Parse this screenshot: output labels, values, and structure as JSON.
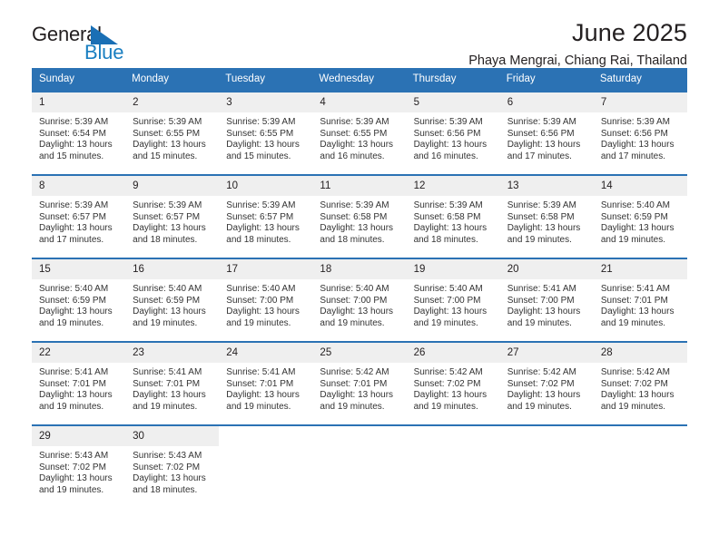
{
  "brand": {
    "name_top": "General",
    "name_bottom": "Blue",
    "flag_icon": "blue-flag-triangle-icon",
    "top_color": "#231f20",
    "bottom_color": "#1a7fc1"
  },
  "header": {
    "title": "June 2025",
    "subtitle": "Phaya Mengrai, Chiang Rai, Thailand"
  },
  "theme": {
    "header_blue": "#2b72b4",
    "daynum_band": "#efefef",
    "text": "#231f20"
  },
  "calendar": {
    "weekday_headers": [
      "Sunday",
      "Monday",
      "Tuesday",
      "Wednesday",
      "Thursday",
      "Friday",
      "Saturday"
    ],
    "weeks": [
      [
        {
          "day": "1",
          "sunrise": "Sunrise: 5:39 AM",
          "sunset": "Sunset: 6:54 PM",
          "daylight_line1": "Daylight: 13 hours",
          "daylight_line2": "and 15 minutes."
        },
        {
          "day": "2",
          "sunrise": "Sunrise: 5:39 AM",
          "sunset": "Sunset: 6:55 PM",
          "daylight_line1": "Daylight: 13 hours",
          "daylight_line2": "and 15 minutes."
        },
        {
          "day": "3",
          "sunrise": "Sunrise: 5:39 AM",
          "sunset": "Sunset: 6:55 PM",
          "daylight_line1": "Daylight: 13 hours",
          "daylight_line2": "and 15 minutes."
        },
        {
          "day": "4",
          "sunrise": "Sunrise: 5:39 AM",
          "sunset": "Sunset: 6:55 PM",
          "daylight_line1": "Daylight: 13 hours",
          "daylight_line2": "and 16 minutes."
        },
        {
          "day": "5",
          "sunrise": "Sunrise: 5:39 AM",
          "sunset": "Sunset: 6:56 PM",
          "daylight_line1": "Daylight: 13 hours",
          "daylight_line2": "and 16 minutes."
        },
        {
          "day": "6",
          "sunrise": "Sunrise: 5:39 AM",
          "sunset": "Sunset: 6:56 PM",
          "daylight_line1": "Daylight: 13 hours",
          "daylight_line2": "and 17 minutes."
        },
        {
          "day": "7",
          "sunrise": "Sunrise: 5:39 AM",
          "sunset": "Sunset: 6:56 PM",
          "daylight_line1": "Daylight: 13 hours",
          "daylight_line2": "and 17 minutes."
        }
      ],
      [
        {
          "day": "8",
          "sunrise": "Sunrise: 5:39 AM",
          "sunset": "Sunset: 6:57 PM",
          "daylight_line1": "Daylight: 13 hours",
          "daylight_line2": "and 17 minutes."
        },
        {
          "day": "9",
          "sunrise": "Sunrise: 5:39 AM",
          "sunset": "Sunset: 6:57 PM",
          "daylight_line1": "Daylight: 13 hours",
          "daylight_line2": "and 18 minutes."
        },
        {
          "day": "10",
          "sunrise": "Sunrise: 5:39 AM",
          "sunset": "Sunset: 6:57 PM",
          "daylight_line1": "Daylight: 13 hours",
          "daylight_line2": "and 18 minutes."
        },
        {
          "day": "11",
          "sunrise": "Sunrise: 5:39 AM",
          "sunset": "Sunset: 6:58 PM",
          "daylight_line1": "Daylight: 13 hours",
          "daylight_line2": "and 18 minutes."
        },
        {
          "day": "12",
          "sunrise": "Sunrise: 5:39 AM",
          "sunset": "Sunset: 6:58 PM",
          "daylight_line1": "Daylight: 13 hours",
          "daylight_line2": "and 18 minutes."
        },
        {
          "day": "13",
          "sunrise": "Sunrise: 5:39 AM",
          "sunset": "Sunset: 6:58 PM",
          "daylight_line1": "Daylight: 13 hours",
          "daylight_line2": "and 19 minutes."
        },
        {
          "day": "14",
          "sunrise": "Sunrise: 5:40 AM",
          "sunset": "Sunset: 6:59 PM",
          "daylight_line1": "Daylight: 13 hours",
          "daylight_line2": "and 19 minutes."
        }
      ],
      [
        {
          "day": "15",
          "sunrise": "Sunrise: 5:40 AM",
          "sunset": "Sunset: 6:59 PM",
          "daylight_line1": "Daylight: 13 hours",
          "daylight_line2": "and 19 minutes."
        },
        {
          "day": "16",
          "sunrise": "Sunrise: 5:40 AM",
          "sunset": "Sunset: 6:59 PM",
          "daylight_line1": "Daylight: 13 hours",
          "daylight_line2": "and 19 minutes."
        },
        {
          "day": "17",
          "sunrise": "Sunrise: 5:40 AM",
          "sunset": "Sunset: 7:00 PM",
          "daylight_line1": "Daylight: 13 hours",
          "daylight_line2": "and 19 minutes."
        },
        {
          "day": "18",
          "sunrise": "Sunrise: 5:40 AM",
          "sunset": "Sunset: 7:00 PM",
          "daylight_line1": "Daylight: 13 hours",
          "daylight_line2": "and 19 minutes."
        },
        {
          "day": "19",
          "sunrise": "Sunrise: 5:40 AM",
          "sunset": "Sunset: 7:00 PM",
          "daylight_line1": "Daylight: 13 hours",
          "daylight_line2": "and 19 minutes."
        },
        {
          "day": "20",
          "sunrise": "Sunrise: 5:41 AM",
          "sunset": "Sunset: 7:00 PM",
          "daylight_line1": "Daylight: 13 hours",
          "daylight_line2": "and 19 minutes."
        },
        {
          "day": "21",
          "sunrise": "Sunrise: 5:41 AM",
          "sunset": "Sunset: 7:01 PM",
          "daylight_line1": "Daylight: 13 hours",
          "daylight_line2": "and 19 minutes."
        }
      ],
      [
        {
          "day": "22",
          "sunrise": "Sunrise: 5:41 AM",
          "sunset": "Sunset: 7:01 PM",
          "daylight_line1": "Daylight: 13 hours",
          "daylight_line2": "and 19 minutes."
        },
        {
          "day": "23",
          "sunrise": "Sunrise: 5:41 AM",
          "sunset": "Sunset: 7:01 PM",
          "daylight_line1": "Daylight: 13 hours",
          "daylight_line2": "and 19 minutes."
        },
        {
          "day": "24",
          "sunrise": "Sunrise: 5:41 AM",
          "sunset": "Sunset: 7:01 PM",
          "daylight_line1": "Daylight: 13 hours",
          "daylight_line2": "and 19 minutes."
        },
        {
          "day": "25",
          "sunrise": "Sunrise: 5:42 AM",
          "sunset": "Sunset: 7:01 PM",
          "daylight_line1": "Daylight: 13 hours",
          "daylight_line2": "and 19 minutes."
        },
        {
          "day": "26",
          "sunrise": "Sunrise: 5:42 AM",
          "sunset": "Sunset: 7:02 PM",
          "daylight_line1": "Daylight: 13 hours",
          "daylight_line2": "and 19 minutes."
        },
        {
          "day": "27",
          "sunrise": "Sunrise: 5:42 AM",
          "sunset": "Sunset: 7:02 PM",
          "daylight_line1": "Daylight: 13 hours",
          "daylight_line2": "and 19 minutes."
        },
        {
          "day": "28",
          "sunrise": "Sunrise: 5:42 AM",
          "sunset": "Sunset: 7:02 PM",
          "daylight_line1": "Daylight: 13 hours",
          "daylight_line2": "and 19 minutes."
        }
      ],
      [
        {
          "day": "29",
          "sunrise": "Sunrise: 5:43 AM",
          "sunset": "Sunset: 7:02 PM",
          "daylight_line1": "Daylight: 13 hours",
          "daylight_line2": "and 19 minutes."
        },
        {
          "day": "30",
          "sunrise": "Sunrise: 5:43 AM",
          "sunset": "Sunset: 7:02 PM",
          "daylight_line1": "Daylight: 13 hours",
          "daylight_line2": "and 18 minutes."
        },
        {
          "day": "",
          "sunrise": "",
          "sunset": "",
          "daylight_line1": "",
          "daylight_line2": ""
        },
        {
          "day": "",
          "sunrise": "",
          "sunset": "",
          "daylight_line1": "",
          "daylight_line2": ""
        },
        {
          "day": "",
          "sunrise": "",
          "sunset": "",
          "daylight_line1": "",
          "daylight_line2": ""
        },
        {
          "day": "",
          "sunrise": "",
          "sunset": "",
          "daylight_line1": "",
          "daylight_line2": ""
        },
        {
          "day": "",
          "sunrise": "",
          "sunset": "",
          "daylight_line1": "",
          "daylight_line2": ""
        }
      ]
    ]
  }
}
